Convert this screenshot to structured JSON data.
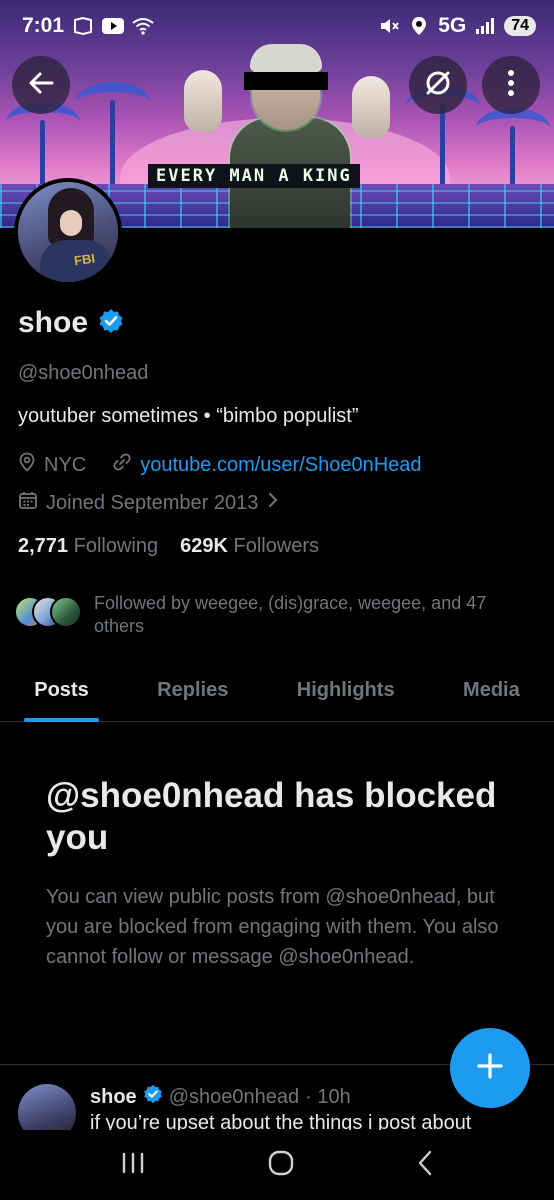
{
  "status_bar": {
    "time": "7:01",
    "network": "5G",
    "battery": "74"
  },
  "banner": {
    "text": "EVERY MAN A KING"
  },
  "profile": {
    "name": "shoe",
    "handle": "@shoe0nhead",
    "bio": "youtuber sometimes • “bimbo populist”",
    "location": "NYC",
    "website": "youtube.com/user/Shoe0nHead",
    "joined": "Joined September 2013",
    "following_count": "2,771",
    "following_label": "Following",
    "followers_count": "629K",
    "followers_label": "Followers",
    "followed_by": "Followed by weegee, (dis)grace, weegee, and 47 others"
  },
  "tabs": [
    {
      "label": "Posts",
      "active": true
    },
    {
      "label": "Replies",
      "active": false
    },
    {
      "label": "Highlights",
      "active": false
    },
    {
      "label": "Media",
      "active": false
    }
  ],
  "blocked": {
    "title": "@shoe0nhead has blocked you",
    "body": "You can view public posts from @shoe0nhead, but you are blocked from engaging with them. You also cannot follow or message @shoe0nhead."
  },
  "post": {
    "name": "shoe",
    "handle": "@shoe0nhead",
    "time": "· 10h",
    "text": "if you’re upset about the things i post about"
  },
  "colors": {
    "accent": "#1d9bf0",
    "background": "#000000",
    "muted": "#71767b"
  },
  "icons": [
    "back-arrow-icon",
    "grok-icon",
    "more-vertical-icon",
    "verified-icon",
    "location-icon",
    "link-icon",
    "calendar-icon",
    "chevron-right-icon",
    "plus-icon"
  ]
}
